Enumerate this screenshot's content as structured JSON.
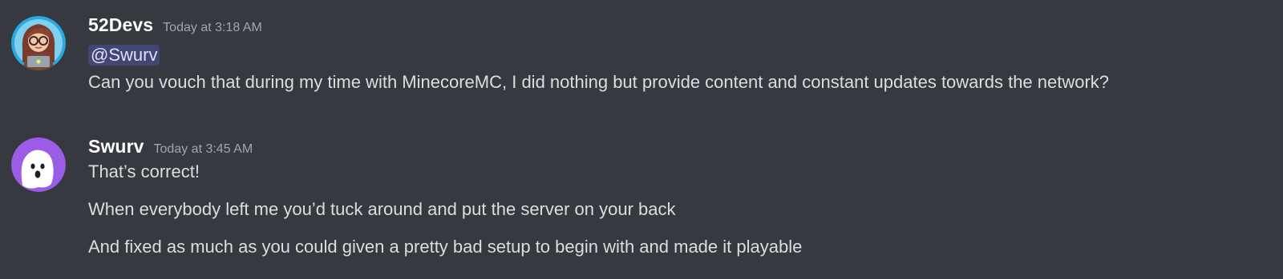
{
  "messages": [
    {
      "username": "52Devs",
      "timestamp": "Today at 3:18 AM",
      "avatar_icon": "girl-with-glasses-laptop-avatar",
      "mention": "@Swurv",
      "lines": [
        "Can you vouch that during my time with MinecoreMC, I did nothing but provide content and constant updates towards the network?"
      ]
    },
    {
      "username": "Swurv",
      "timestamp": "Today at 3:45 AM",
      "avatar_icon": "white-ghost-face-avatar",
      "lines": [
        "That’s correct!",
        "When everybody left me you’d tuck around and put the server on your back",
        "And fixed as much as you could given a pretty bad setup to begin with and made it playable"
      ]
    }
  ],
  "colors": {
    "background": "#36393f",
    "mention_bg": "#414675",
    "mention_text": "#dee0fc",
    "username": "#ffffff",
    "timestamp": "#a3a6aa",
    "message_text": "#dcddde",
    "avatar2_bg": "#9b5de5"
  }
}
